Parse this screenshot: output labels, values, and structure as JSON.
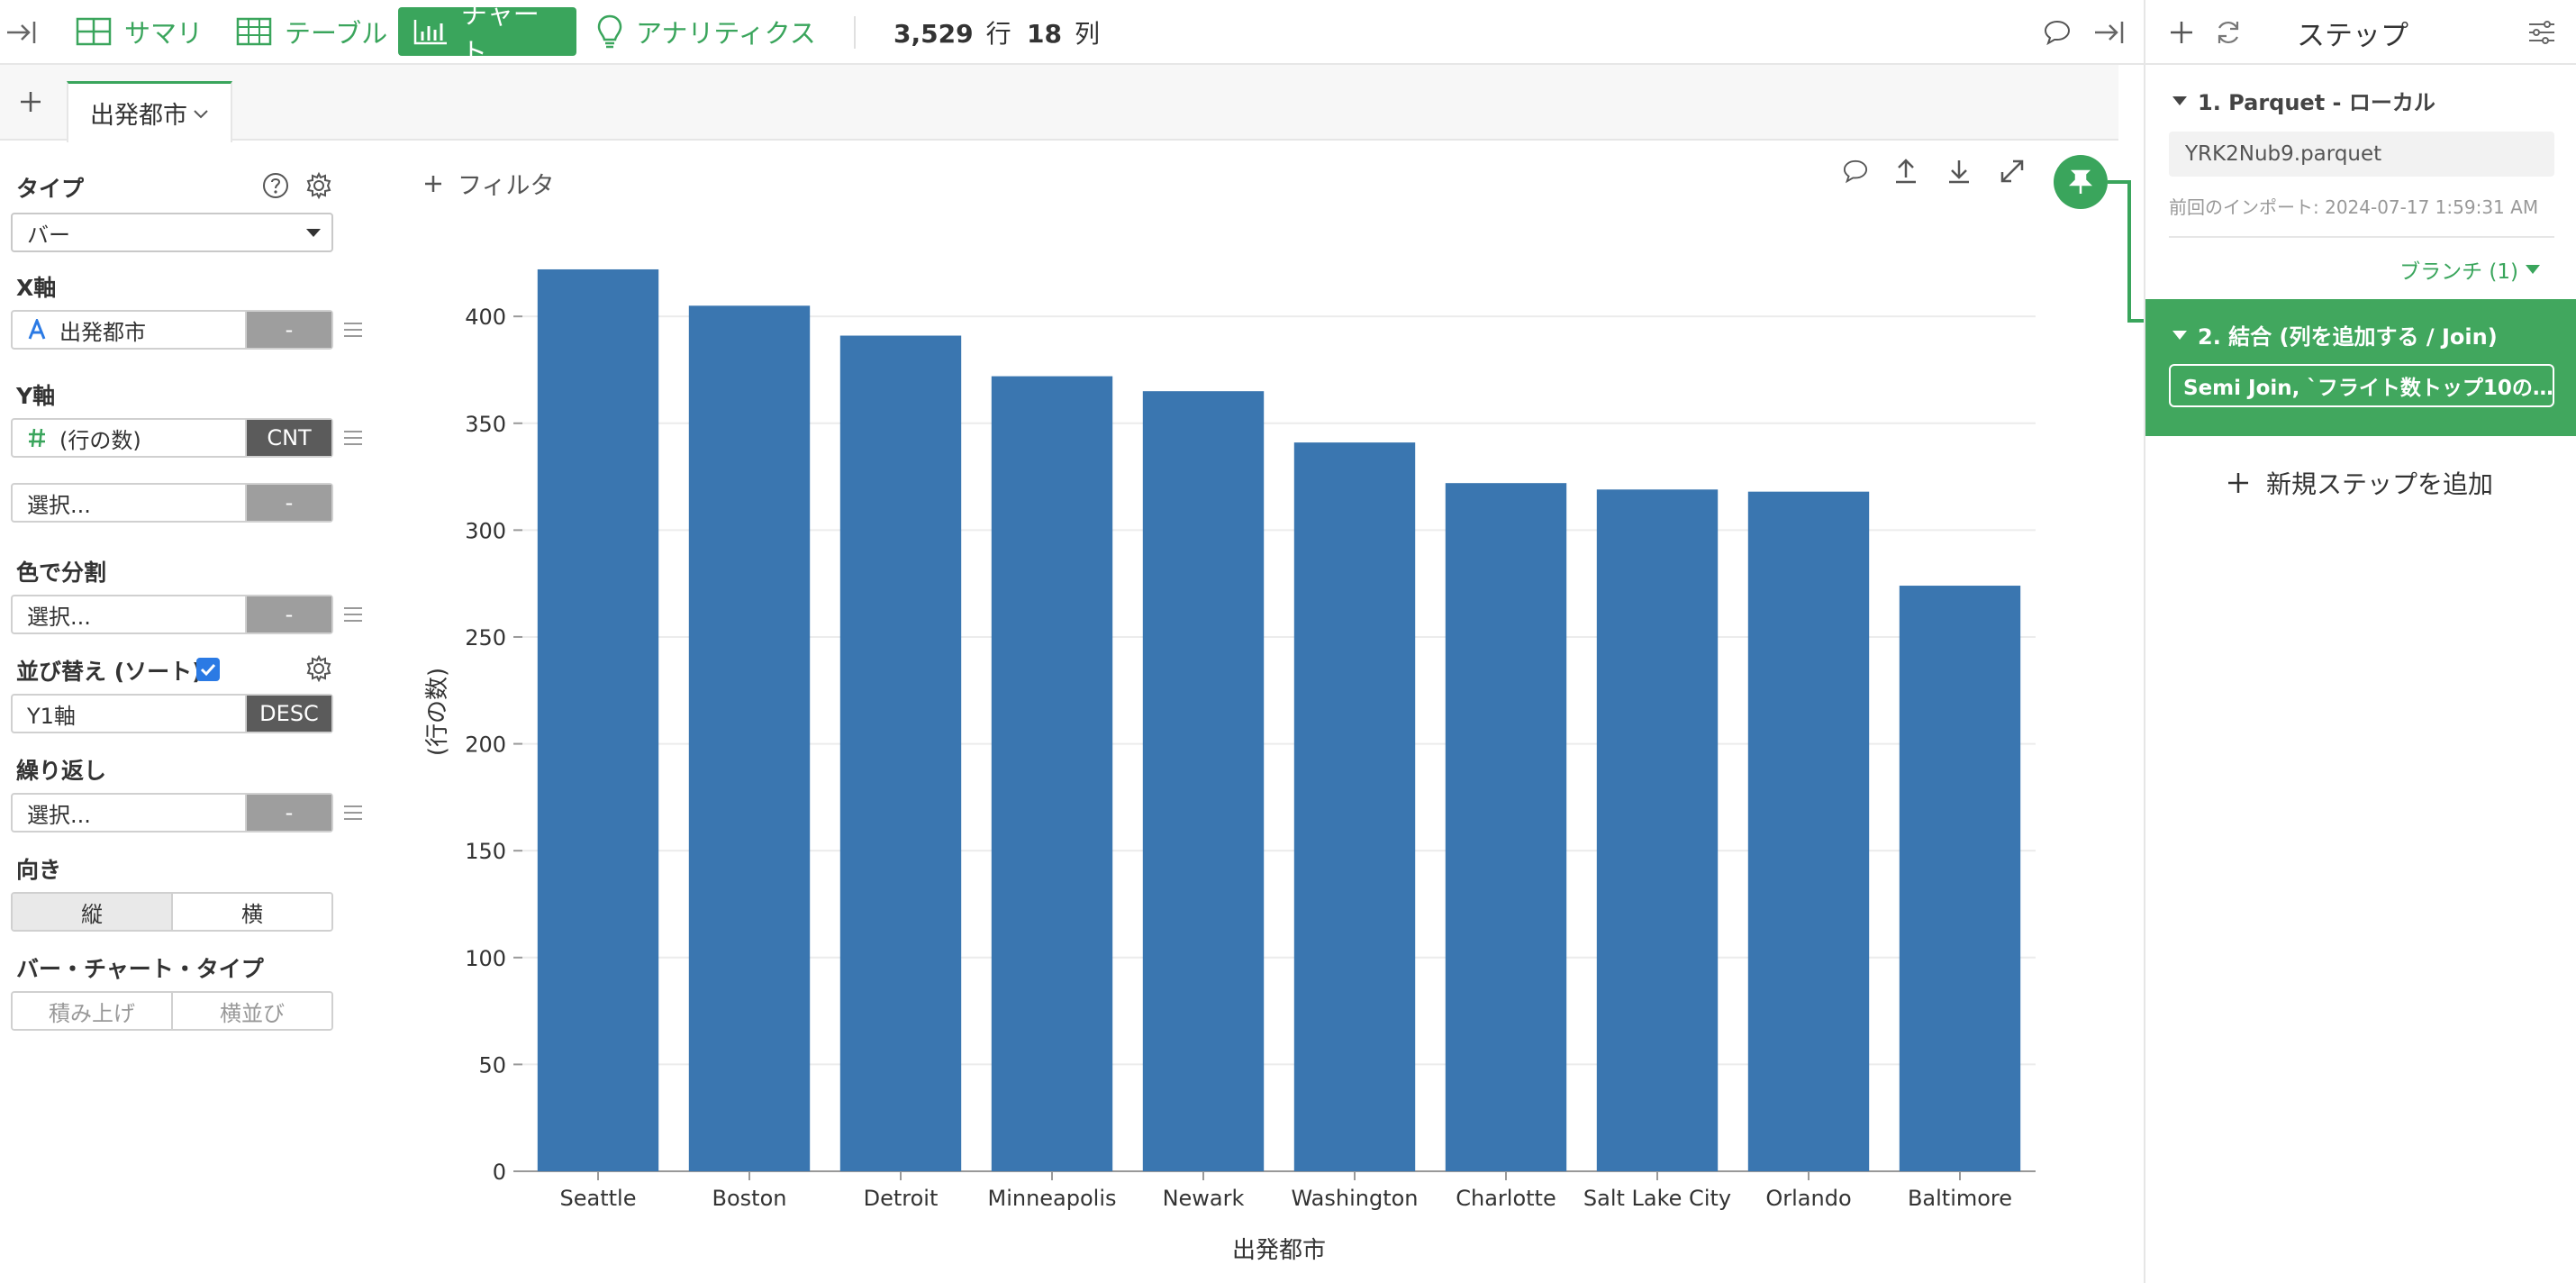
{
  "toolbar": {
    "tabs": [
      {
        "label": "サマリ",
        "icon": "summary-grid-icon",
        "active": false
      },
      {
        "label": "テーブル",
        "icon": "table-icon",
        "active": false
      },
      {
        "label": "チャート",
        "icon": "bar-chart-icon",
        "active": true
      },
      {
        "label": "アナリティクス",
        "icon": "lightbulb-icon",
        "active": false
      }
    ],
    "rows_value": "3,529",
    "rows_unit": "行",
    "cols_value": "18",
    "cols_unit": "列"
  },
  "chart_tabs": {
    "add_label": "+",
    "active_tab": "出発都市"
  },
  "config": {
    "type_label": "タイプ",
    "type_value": "バー",
    "x_axis_label": "X軸",
    "x_axis_field": "出発都市",
    "x_axis_agg": "-",
    "y_axis_label": "Y軸",
    "y_axis_field": "(行の数)",
    "y_axis_agg": "CNT",
    "y_axis2_field": "選択...",
    "y_axis2_agg": "-",
    "color_label": "色で分割",
    "color_field": "選択...",
    "color_agg": "-",
    "sort_label": "並び替え (ソート)",
    "sort_field": "Y1軸",
    "sort_order": "DESC",
    "repeat_label": "繰り返し",
    "repeat_field": "選択...",
    "repeat_agg": "-",
    "orientation_label": "向き",
    "orientation_vertical": "縦",
    "orientation_horizontal": "横",
    "bar_type_label": "バー・チャート・タイプ",
    "bar_type_stacked": "積み上げ",
    "bar_type_grouped": "横並び"
  },
  "chart": {
    "filter_label": "フィルタ"
  },
  "chart_data": {
    "type": "bar",
    "categories": [
      "Seattle",
      "Boston",
      "Detroit",
      "Minneapolis",
      "Newark",
      "Washington",
      "Charlotte",
      "Salt Lake City",
      "Orlando",
      "Baltimore"
    ],
    "values": [
      422,
      405,
      391,
      372,
      365,
      341,
      322,
      319,
      318,
      274
    ],
    "xlabel": "出発都市",
    "ylabel": "(行の数)",
    "ylim": [
      0,
      430
    ],
    "yticks": [
      0,
      50,
      100,
      150,
      200,
      250,
      300,
      350,
      400
    ],
    "bar_color": "#3a76b0",
    "grid": true
  },
  "steps": {
    "title": "ステップ",
    "step1_title": "1. Parquet - ローカル",
    "step1_file": "YRK2Nub9.parquet",
    "step1_import": "前回のインポート: 2024-07-17 1:59:31 AM",
    "branch_label": "ブランチ (1)",
    "step2_title": "2. 結合 (列を追加する / Join)",
    "step2_detail": "Semi Join, `フライト数トップ10の…",
    "add_step_label": "新規ステップを追加"
  },
  "colors": {
    "accent": "#3aa55c",
    "bar": "#3a76b0",
    "step_active": "#41a75e"
  }
}
